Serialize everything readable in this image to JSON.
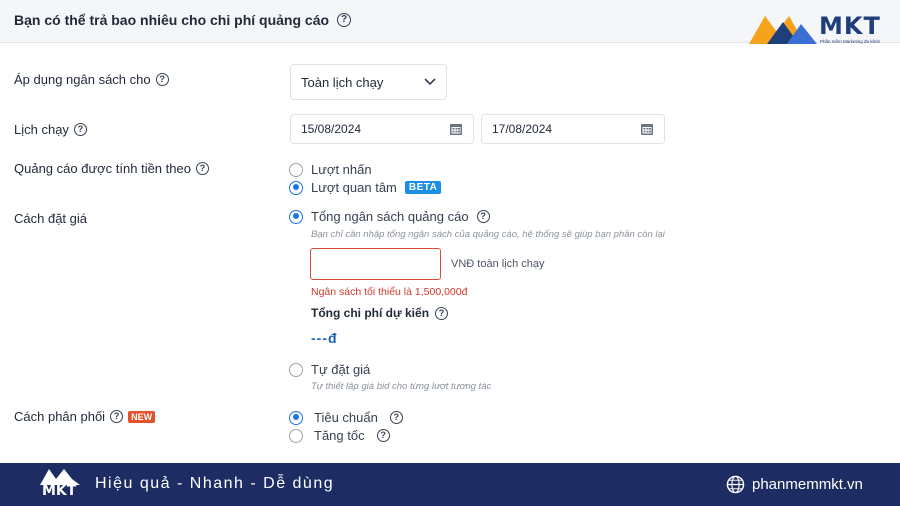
{
  "header": {
    "title": "Bạn có thể trả bao nhiêu cho chi phí quảng cáo"
  },
  "logo": {
    "text": "MKT",
    "tagline": "Phần mềm Marketing đa kênh"
  },
  "budget_scope": {
    "label": "Áp dụng ngân sách cho",
    "selected": "Toàn lịch chạy"
  },
  "schedule": {
    "label": "Lịch chạy",
    "start_date": "15/08/2024",
    "end_date": "17/08/2024"
  },
  "billing": {
    "label": "Quảng cáo được tính tiền theo",
    "options": [
      {
        "label": "Lượt nhấn",
        "selected": false
      },
      {
        "label": "Lượt quan tâm",
        "selected": true,
        "badge": "BETA"
      }
    ]
  },
  "bidding": {
    "label": "Cách đặt giá",
    "total_budget": {
      "label": "Tổng ngân sách quảng cáo",
      "hint": "Bạn chỉ cần nhập tổng ngân sách của quảng cáo, hệ thống sẽ giúp bạn phần còn lại",
      "input_value": "",
      "unit": "VNĐ toàn lịch chạy",
      "error": "Ngân sách tối thiểu là 1,500,000đ",
      "estimated_label": "Tổng chi phí dự kiến",
      "estimated_value": "---đ",
      "selected": true
    },
    "manual": {
      "label": "Tự đặt giá",
      "hint": "Tự thiết lập giá bid cho từng lượt tương tác",
      "selected": false
    }
  },
  "delivery": {
    "label": "Cách phân phối",
    "badge": "NEW",
    "options": [
      {
        "label": "Tiêu chuẩn",
        "selected": true
      },
      {
        "label": "Tăng tốc",
        "selected": false
      }
    ]
  },
  "footer": {
    "slogan": "Hiệu quả - Nhanh - Dễ dùng",
    "website": "phanmemmkt.vn",
    "logo_text": "MKT"
  },
  "colors": {
    "accent": "#1a73e8",
    "error": "#d0392b",
    "footer_bg": "#1d2c63",
    "logo_orange": "#f7a21b"
  }
}
